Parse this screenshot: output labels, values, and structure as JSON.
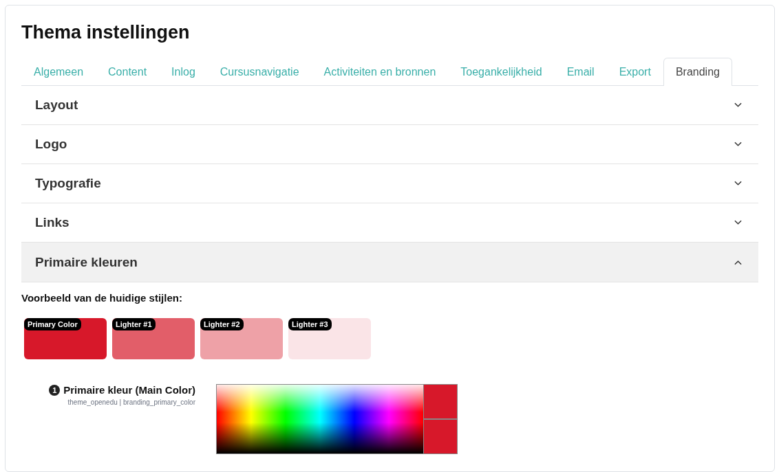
{
  "page": {
    "title": "Thema instellingen"
  },
  "tabs": [
    {
      "label": "Algemeen",
      "selected": false
    },
    {
      "label": "Content",
      "selected": false
    },
    {
      "label": "Inlog",
      "selected": false
    },
    {
      "label": "Cursusnavigatie",
      "selected": false
    },
    {
      "label": "Activiteiten en bronnen",
      "selected": false
    },
    {
      "label": "Toegankelijkheid",
      "selected": false
    },
    {
      "label": "Email",
      "selected": false
    },
    {
      "label": "Export",
      "selected": false
    },
    {
      "label": "Branding",
      "selected": true
    }
  ],
  "sections": [
    {
      "title": "Layout",
      "expanded": false
    },
    {
      "title": "Logo",
      "expanded": false
    },
    {
      "title": "Typografie",
      "expanded": false
    },
    {
      "title": "Links",
      "expanded": false
    },
    {
      "title": "Primaire kleuren",
      "expanded": true
    }
  ],
  "preview": {
    "heading": "Voorbeeld van de huidige stijlen:",
    "swatches": [
      {
        "label": "Primary Color",
        "color": "#d7182a"
      },
      {
        "label": "Lighter #1",
        "color": "#e25e69"
      },
      {
        "label": "Lighter #2",
        "color": "#eea1a7"
      },
      {
        "label": "Lighter #3",
        "color": "#fae4e7"
      }
    ]
  },
  "setting": {
    "number": "1",
    "label": "Primaire kleur (Main Color)",
    "path": "theme_openedu | branding_primary_color",
    "color_previews": [
      {
        "color": "#d7182a"
      },
      {
        "color": "#d7182a"
      }
    ]
  }
}
